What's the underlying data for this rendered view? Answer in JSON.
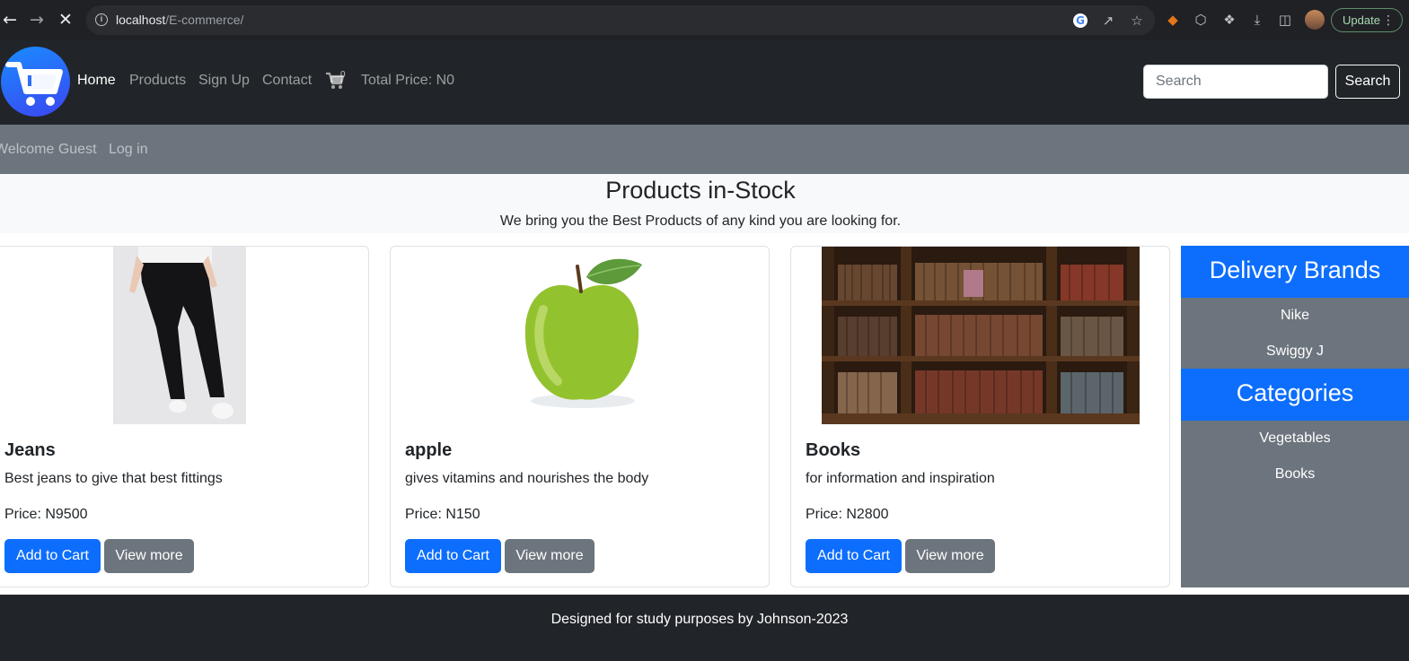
{
  "browser": {
    "url_host": "localhost",
    "url_path": "/E-commerce/",
    "update_label": "Update"
  },
  "navbar": {
    "links": {
      "home": "Home",
      "products": "Products",
      "signup": "Sign Up",
      "contact": "Contact"
    },
    "cart_count": "0",
    "total_price": "Total Price: N0",
    "search_placeholder": "Search",
    "search_button": "Search"
  },
  "subnav": {
    "welcome": "Welcome Guest",
    "login": "Log in"
  },
  "hero": {
    "title": "Products in-Stock",
    "subtitle": "We bring you the Best Products of any kind you are looking for."
  },
  "products": [
    {
      "title": "Jeans",
      "description": "Best jeans to give that best fittings",
      "price": "Price: N9500",
      "add_label": "Add to Cart",
      "view_label": "View more"
    },
    {
      "title": "apple",
      "description": "gives vitamins and nourishes the body",
      "price": "Price: N150",
      "add_label": "Add to Cart",
      "view_label": "View more"
    },
    {
      "title": "Books",
      "description": "for information and inspiration",
      "price": "Price: N2800",
      "add_label": "Add to Cart",
      "view_label": "View more"
    }
  ],
  "sidebar": {
    "brands_heading": "Delivery Brands",
    "brands": [
      "Nike",
      "Swiggy J"
    ],
    "categories_heading": "Categories",
    "categories": [
      "Vegetables",
      "Books"
    ]
  },
  "footer": {
    "text": "Designed for study purposes by Johnson-2023"
  },
  "colors": {
    "primary": "#0d6efd",
    "secondary": "#6c757d",
    "dark": "#212529",
    "light": "#f8f9fa"
  },
  "icons": {
    "logo": "shopping-cart-logo-icon",
    "cart": "shopping-cart-icon"
  }
}
